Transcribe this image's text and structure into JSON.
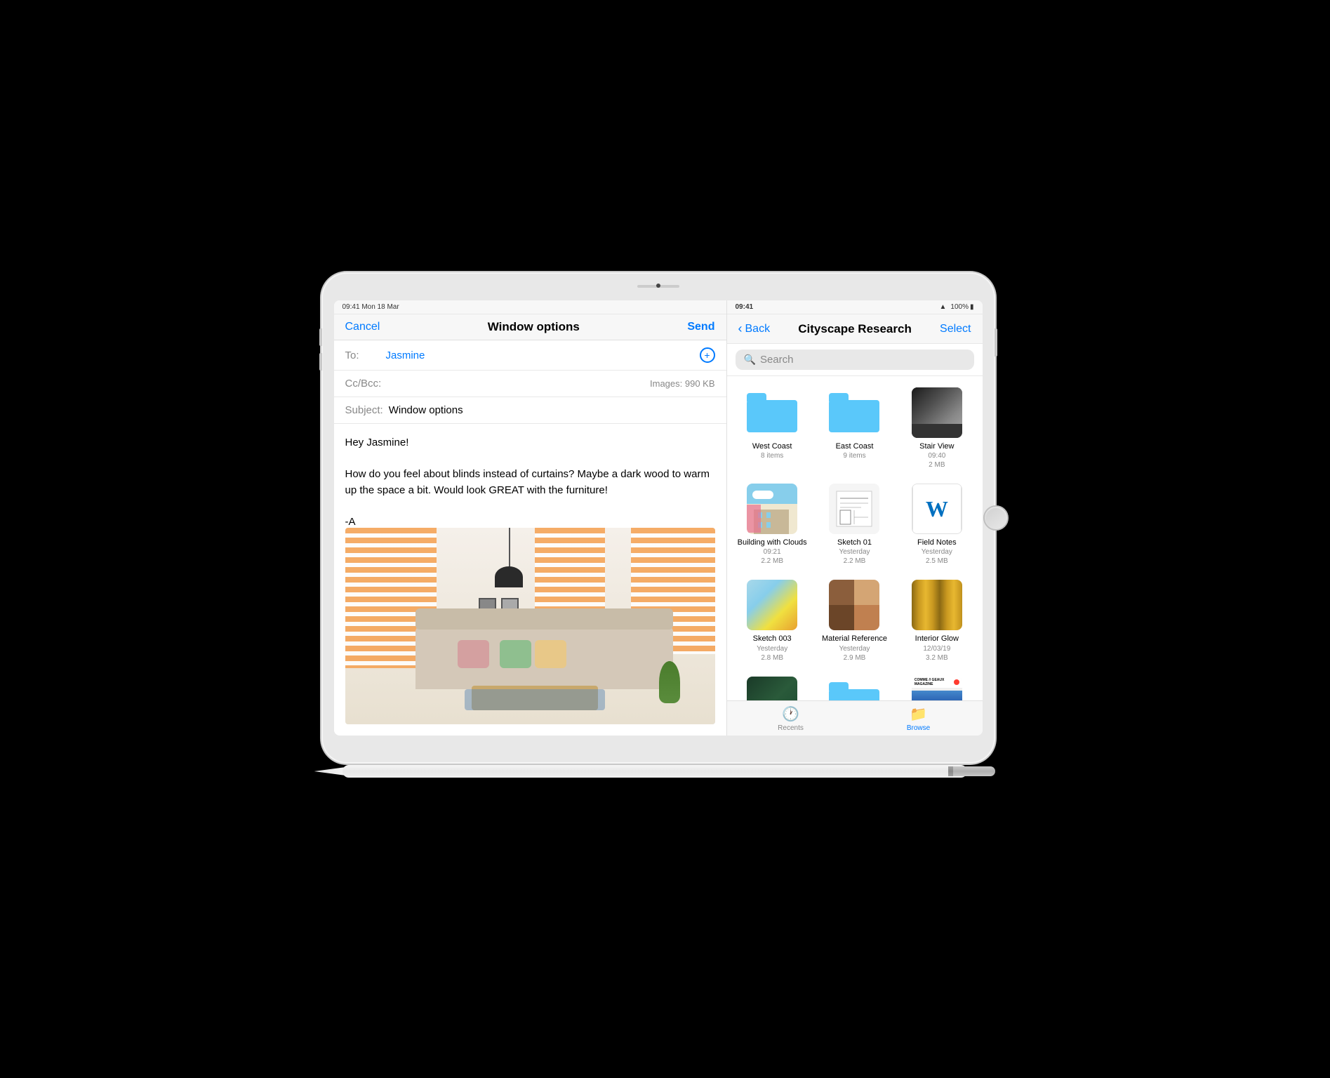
{
  "scene": {
    "background": "#000"
  },
  "mail": {
    "status_bar": {
      "time": "09:41",
      "date": "Mon 18 Mar"
    },
    "toolbar": {
      "cancel_label": "Cancel",
      "title": "Window options",
      "send_label": "Send"
    },
    "to_label": "To:",
    "to_value": "Jasmine",
    "cc_label": "Cc/Bcc:",
    "images_label": "Images: 990 KB",
    "subject_label": "Subject:",
    "subject_value": "Window options",
    "body_lines": [
      "Hey Jasmine!",
      "",
      "How do you feel about blinds instead of curtains? Maybe a dark wood to warm up the space a bit. Would look GREAT with the furniture!",
      "",
      "-A"
    ]
  },
  "files": {
    "status_bar": {
      "wifi": "wifi",
      "battery": "100%"
    },
    "nav": {
      "back_label": "Back",
      "title": "Cityscape Research",
      "select_label": "Select"
    },
    "search": {
      "placeholder": "Search"
    },
    "items": [
      {
        "type": "folder",
        "name": "West Coast",
        "meta1": "8 items",
        "meta2": ""
      },
      {
        "type": "folder",
        "name": "East Coast",
        "meta1": "9 items",
        "meta2": ""
      },
      {
        "type": "image",
        "thumb": "stair",
        "name": "Stair View",
        "meta1": "09:40",
        "meta2": "2 MB"
      },
      {
        "type": "image",
        "thumb": "building",
        "name": "Building with Clouds",
        "meta1": "09:21",
        "meta2": "2.2 MB"
      },
      {
        "type": "image",
        "thumb": "sketch01",
        "name": "Sketch 01",
        "meta1": "Yesterday",
        "meta2": "2.2 MB"
      },
      {
        "type": "doc",
        "thumb": "fieldnotes",
        "name": "Field Notes",
        "meta1": "Yesterday",
        "meta2": "2.5 MB"
      },
      {
        "type": "image",
        "thumb": "sketch003",
        "name": "Sketch 003",
        "meta1": "Yesterday",
        "meta2": "2.8 MB"
      },
      {
        "type": "image",
        "thumb": "material",
        "name": "Material Reference",
        "meta1": "Yesterday",
        "meta2": "2.9 MB"
      },
      {
        "type": "image",
        "thumb": "interior",
        "name": "Interior Glow",
        "meta1": "12/03/19",
        "meta2": "3.2 MB"
      },
      {
        "type": "image",
        "thumb": "greenbook",
        "name": "",
        "meta1": "",
        "meta2": ""
      },
      {
        "type": "folder",
        "name": "",
        "meta1": "",
        "meta2": ""
      },
      {
        "type": "image",
        "thumb": "magazine",
        "name": "",
        "meta1": "",
        "meta2": ""
      }
    ],
    "tabbar": {
      "recents_label": "Recents",
      "browse_label": "Browse"
    }
  }
}
